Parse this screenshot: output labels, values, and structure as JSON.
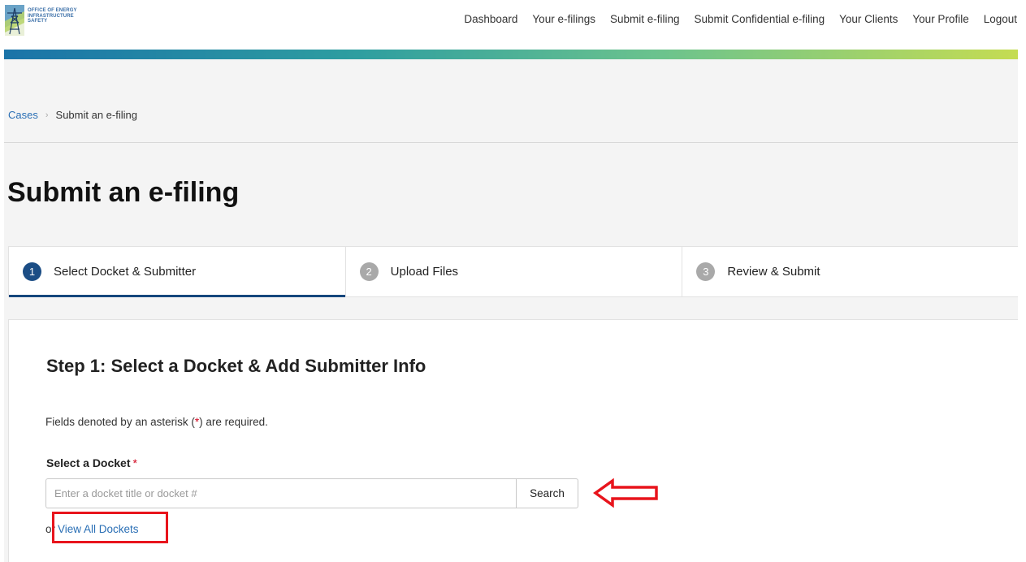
{
  "logo": {
    "lines": [
      "OFFICE OF ENERGY",
      "INFRASTRUCTURE",
      "SAFETY"
    ]
  },
  "topnav": {
    "items": [
      {
        "label": "Dashboard"
      },
      {
        "label": "Your e-filings"
      },
      {
        "label": "Submit e-filing"
      },
      {
        "label": "Submit Confidential e-filing"
      },
      {
        "label": "Your Clients"
      },
      {
        "label": "Your Profile"
      },
      {
        "label": "Logout"
      }
    ]
  },
  "breadcrumb": {
    "root": "Cases",
    "separator": "›",
    "current": "Submit an e-filing"
  },
  "page": {
    "title": "Submit an e-filing"
  },
  "stepper": {
    "steps": [
      {
        "number": "1",
        "label": "Select Docket & Submitter",
        "state": "active"
      },
      {
        "number": "2",
        "label": "Upload Files",
        "state": "inactive"
      },
      {
        "number": "3",
        "label": "Review & Submit",
        "state": "inactive"
      }
    ]
  },
  "form": {
    "heading": "Step 1: Select a Docket & Add Submitter Info",
    "required_note_pre": "Fields denoted by an asterisk (",
    "required_note_mark": "*",
    "required_note_post": ") are required.",
    "docket_label": "Select a Docket",
    "docket_required_mark": "*",
    "docket_placeholder": "Enter a docket title or docket #",
    "docket_value": "",
    "search_label": "Search",
    "or_text": "or",
    "view_all_label": "View All Dockets"
  },
  "colors": {
    "accent": "#15477d",
    "link": "#2a6fb5",
    "annotation": "#e8141c"
  }
}
